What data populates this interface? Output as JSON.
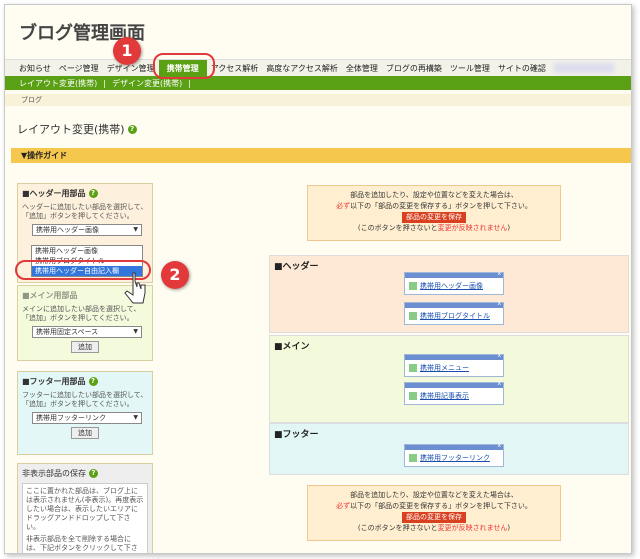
{
  "title": "ブログ管理画面",
  "nav": [
    "お知らせ",
    "ページ管理",
    "デザイン管理",
    "携帯管理",
    "アクセス解析",
    "高度なアクセス解析",
    "全体管理",
    "ブログの再構築",
    "ツール管理",
    "サイトの確認"
  ],
  "subnav": [
    "レイアウト変更(携帯)",
    "|",
    "デザイン変更(携帯)",
    "|"
  ],
  "breadcrumb": "ブログ",
  "page_title": "レイアウト変更(携帯)",
  "guide": "▼操作ガイド",
  "header_panel": {
    "title": "■ヘッダー用部品",
    "desc": "ヘッダーに追加したい部品を選択して、「追加」ボタンを押してください。",
    "selected": "携帯用ヘッダー画像",
    "options": [
      "携帯用ヘッダー画像",
      "携帯用ブログタイトル",
      "携帯用ヘッダー自由記入欄"
    ]
  },
  "main_panel": {
    "title": "■メイン用部品",
    "desc": "メインに追加したい部品を選択して、「追加」ボタンを押してください。",
    "selected": "携帯用固定スペース",
    "add": "追加"
  },
  "footer_panel": {
    "title": "■フッター用部品",
    "desc": "フッターに追加したい部品を選択して、「追加」ボタンを押してください。",
    "selected": "携帯用フッターリンク",
    "add": "追加"
  },
  "hidden_panel": {
    "title": "非表示部品の保存",
    "desc1": "ここに置かれた部品は、ブログ上には表示されません(非表示)。再度表示したい場合は、表示したいエリアにドラッグアンドドロップして下さい。",
    "desc2": "非表示部品を全て削除する場合には、下記ボタンをクリックして下さい。"
  },
  "notice": {
    "line1": "部品を追加したり、設定や位置などを変えた場合は、",
    "line2_red": "必ず",
    "line2": "以下の「部品の変更を保存する」ボタンを押して下さい。",
    "button": "部品の変更を保存",
    "line3a": "(このボタンを押さないと",
    "line3_red": "変更が反映されません",
    "line3b": ")"
  },
  "sections": {
    "header": {
      "title": "■ヘッダー",
      "widgets": [
        "携帯用ヘッダー画像",
        "携帯用ブログタイトル"
      ]
    },
    "main": {
      "title": "■メイン",
      "widgets": [
        "携帯用メニュー",
        "携帯用記事表示"
      ]
    },
    "footer": {
      "title": "■フッター",
      "widgets": [
        "携帯用フッターリンク"
      ]
    }
  },
  "callouts": [
    "1",
    "2"
  ],
  "widget_close": "x",
  "help_glyph": "?",
  "arrow_glyph": "▼",
  "colors": {
    "accent_green": "#5aa014",
    "callout_red": "#e23a3a",
    "guide_yellow": "#f5c74d"
  }
}
